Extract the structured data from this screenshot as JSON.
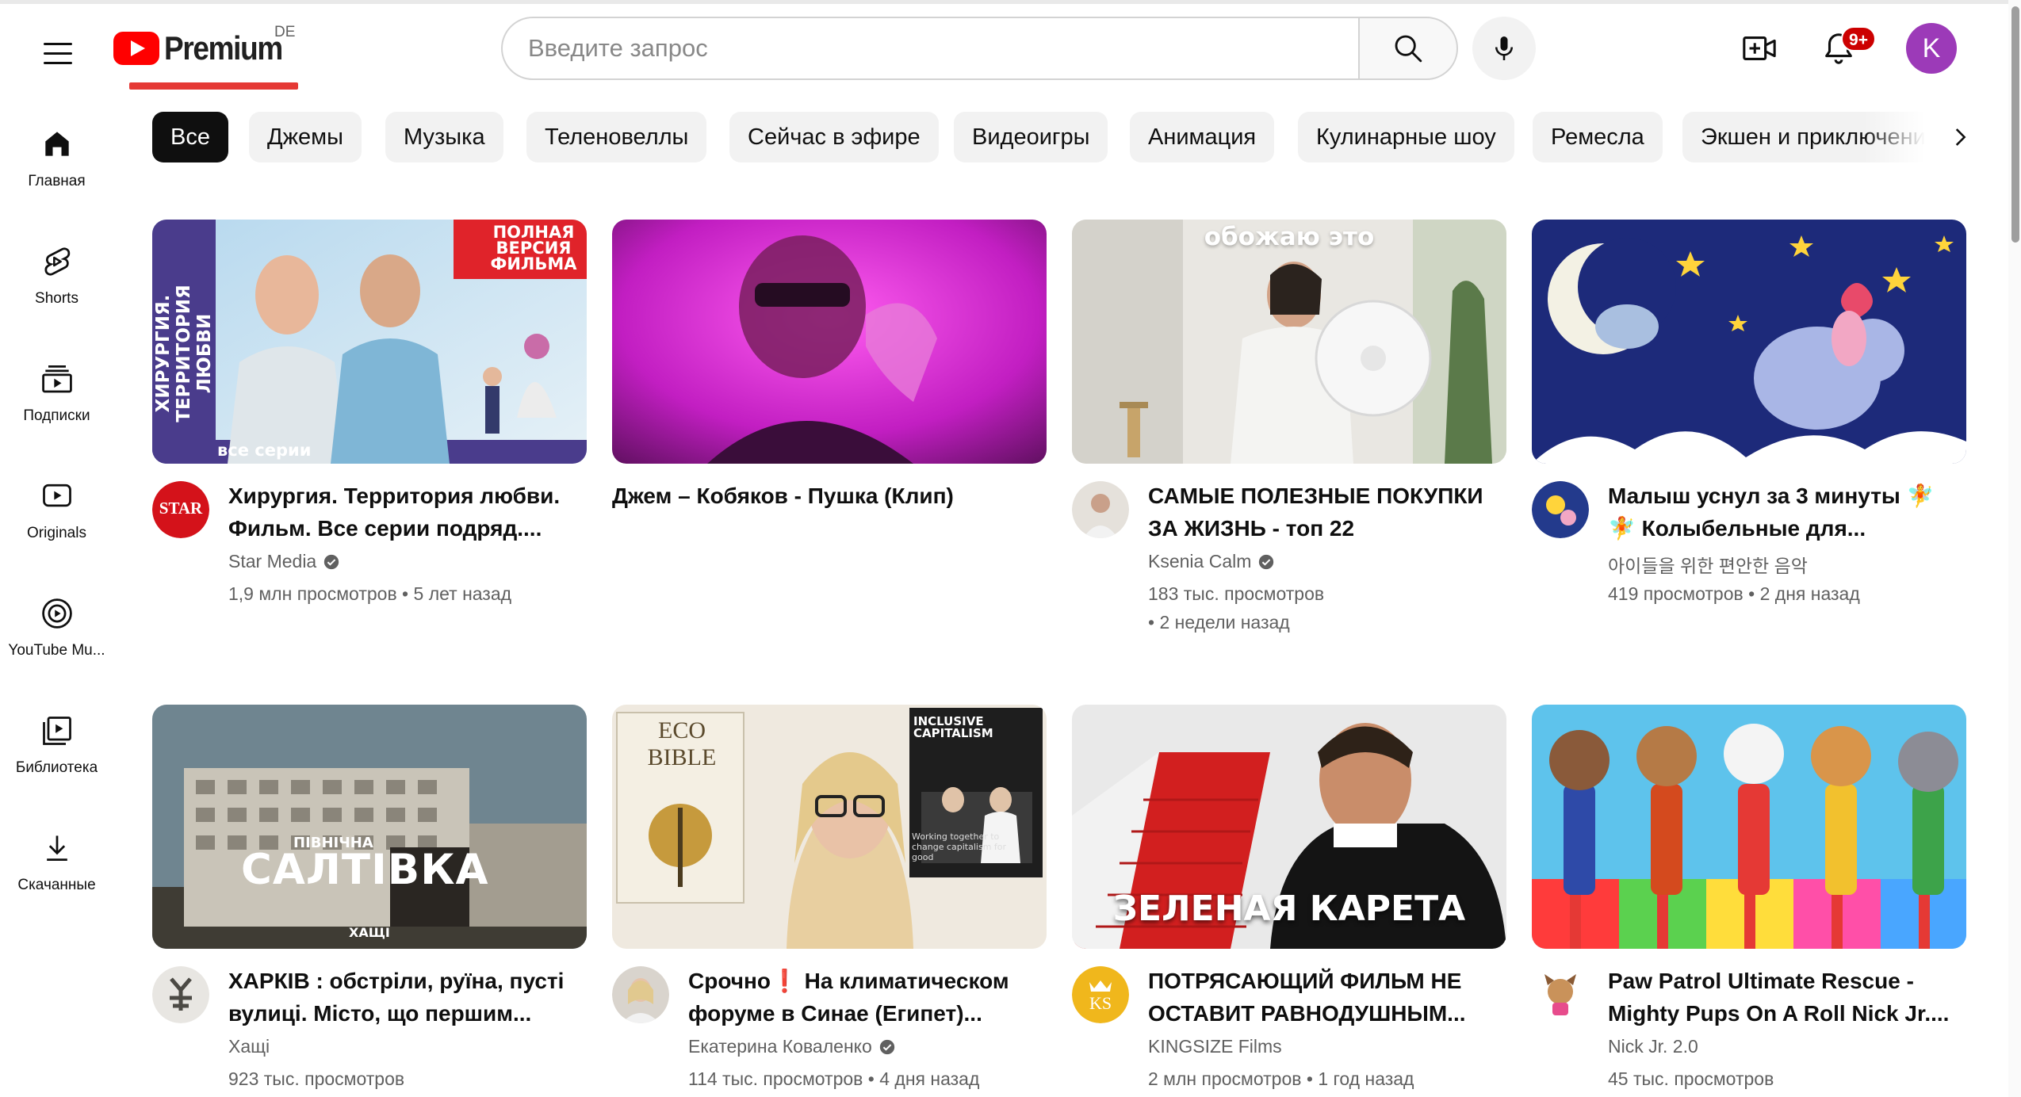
{
  "header": {
    "logo_text": "Premium",
    "region": "DE",
    "search_placeholder": "Введите запрос",
    "notification_count": "9+",
    "avatar_letter": "K"
  },
  "sidebar": {
    "items": [
      {
        "label": "Главная",
        "icon": "home-icon"
      },
      {
        "label": "Shorts",
        "icon": "shorts-icon"
      },
      {
        "label": "Подписки",
        "icon": "subscriptions-icon"
      },
      {
        "label": "Originals",
        "icon": "originals-icon"
      },
      {
        "label": "YouTube Mu...",
        "icon": "youtube-music-icon"
      },
      {
        "label": "Библиотека",
        "icon": "library-icon"
      },
      {
        "label": "Скачанные",
        "icon": "download-icon"
      }
    ]
  },
  "chips": [
    "Все",
    "Джемы",
    "Музыка",
    "Теленовеллы",
    "Сейчас в эфире",
    "Видеоигры",
    "Анимация",
    "Кулинарные шоу",
    "Ремесла",
    "Экшен и приключения"
  ],
  "videos": [
    {
      "title": "Хирургия. Территория любви. Фильм. Все серии подряд....",
      "channel": "Star Media",
      "verified": true,
      "views": "1,9 млн просмотров",
      "age": "5 лет назад",
      "overlay_badge": "ПОЛНАЯ ВЕРСИЯ ФИЛЬМА",
      "overlay_side": "ХИРУРГИЯ. ТЕРРИТОРИЯ ЛЮБВИ",
      "overlay_bottom": "все серии",
      "avatar_text": "STAR"
    },
    {
      "title": "Джем – Кобяков - Пушка (Клип)",
      "channel": "",
      "verified": false,
      "views": "",
      "age": ""
    },
    {
      "title": "САМЫЕ ПОЛЕЗНЫЕ ПОКУПКИ ЗА ЖИЗНЬ - топ 22",
      "channel": "Ksenia Calm",
      "verified": true,
      "views": "183 тыс. просмотров",
      "age": "2 недели назад",
      "overlay_top": "обожаю это"
    },
    {
      "title": "Малыш уснул за 3 минуты 🧚 🧚 Колыбельные для...",
      "channel": "아이들을 위한 편안한 음악",
      "verified": false,
      "views": "419 просмотров",
      "age": "2 дня назад"
    },
    {
      "title": "ХАРКІВ : обстріли, руїна, пусті вулиці. Місто, що першим...",
      "channel": "Хащі",
      "verified": false,
      "views": "923 тыс. просмотров",
      "age": "",
      "overlay_small": "ПІВНІЧНА",
      "overlay_big": "САЛТІВКА",
      "overlay_logo": "ХАЩІ"
    },
    {
      "title": "Срочно❗ На климатическом форуме в Синае (Египет)...",
      "channel": "Екатерина Коваленко",
      "verified": true,
      "views": "114 тыс. просмотров",
      "age": "4 дня назад",
      "overlay_book": "ECO BIBLE",
      "overlay_panel": "INCLUSIVE CAPITALISM",
      "overlay_panel_sub": "Working together to change capitalism for good"
    },
    {
      "title": "ПОТРЯСАЮЩИЙ ФИЛЬМ НЕ ОСТАВИТ РАВНОДУШНЫМ...",
      "channel": "KINGSIZE Films",
      "verified": false,
      "views": "2 млн просмотров",
      "age": "1 год назад",
      "overlay_big": "ЗЕЛЕНАЯ КАРЕТА",
      "avatar_text": "KS"
    },
    {
      "title": "Paw Patrol Ultimate Rescue - Mighty Pups On A Roll Nick Jr....",
      "channel": "Nick Jr. 2.0",
      "verified": false,
      "views": "45 тыс. просмотров",
      "age": ""
    }
  ],
  "colors": {
    "brand_red": "#ff0000",
    "active_chip": "#0f0f0f",
    "chip_bg": "#f2f2f2",
    "secondary_text": "#606060",
    "avatar_bg": "#9c3ab8"
  }
}
